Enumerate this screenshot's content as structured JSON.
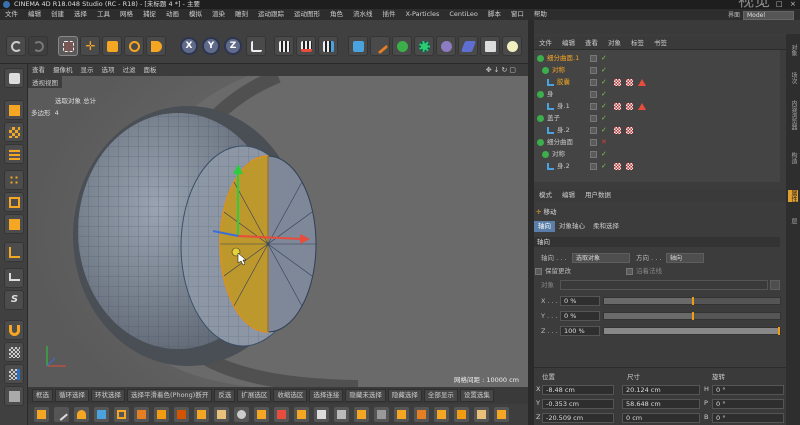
{
  "window": {
    "title": "CINEMA 4D R18.048 Studio (RC - R18) - [未标题 4 *] - 主要",
    "watermark": "视觉"
  },
  "menubar": {
    "items": [
      "文件",
      "编辑",
      "创建",
      "选择",
      "工具",
      "网格",
      "捕捉",
      "动画",
      "模拟",
      "渲染",
      "雕刻",
      "运动跟踪",
      "运动图形",
      "角色",
      "流水线",
      "插件",
      "X-Particles",
      "CentiLeo",
      "脚本",
      "窗口",
      "帮助"
    ],
    "layout_label": "界面",
    "layout_value": "Model"
  },
  "viewport": {
    "menu": [
      "查看",
      "摄像机",
      "显示",
      "选项",
      "过滤",
      "面板"
    ],
    "label": "透视视图",
    "hud_header": "选取对象 总计",
    "hud_row_label": "多边形",
    "hud_row_value": "4",
    "grid_spacing": "网格间距 : 10000 cm"
  },
  "cmdbar": {
    "items": [
      "框选",
      "循环选择",
      "环状选择",
      "选择平滑着色(Phong)断开",
      "反选",
      "扩展选区",
      "收缩选区",
      "选择连接",
      "隐藏未选择",
      "隐藏选择",
      "全部显示",
      "设置选集"
    ]
  },
  "objects": {
    "menu": [
      "文件",
      "编辑",
      "查看",
      "对象",
      "标签",
      "书签"
    ],
    "rows": [
      {
        "name": "细分曲面.1",
        "highlight": true
      },
      {
        "name": "对称",
        "highlight": true
      },
      {
        "name": "胶囊",
        "highlight": true
      },
      {
        "name": "身",
        "highlight": false
      },
      {
        "name": "身.1",
        "highlight": false
      },
      {
        "name": "盖子",
        "highlight": false
      },
      {
        "name": "身.2",
        "highlight": false
      },
      {
        "name": "细分曲面",
        "highlight": false
      },
      {
        "name": "对称",
        "highlight": false
      },
      {
        "name": "身.2",
        "highlight": false
      }
    ]
  },
  "attributes": {
    "menu": [
      "模式",
      "编辑",
      "用户数据"
    ],
    "title": "移动",
    "tabs": [
      "轴向",
      "对象轴心",
      "柔和选择"
    ],
    "section": "轴向",
    "axis_label": "轴向 . . .",
    "axis_value": "选取对象",
    "dir_label": "方向 . . .",
    "dir_value": "轴向",
    "keep_label": "保留更改",
    "snap_label": "沿着法线",
    "object_label": "对象",
    "x_label": "X . . .",
    "x_value": "0 %",
    "y_label": "Y . . .",
    "y_value": "0 %",
    "z_label": "Z . . .",
    "z_value": "100 %"
  },
  "coords": {
    "headers": [
      "位置",
      "尺寸",
      "旋转"
    ],
    "rows": [
      {
        "axis": "X",
        "pos": "-8.48 cm",
        "size": "20.124 cm",
        "rot_axis": "H",
        "rot": "0 °"
      },
      {
        "axis": "Y",
        "pos": "-0.353 cm",
        "size": "58.648 cm",
        "rot_axis": "P",
        "rot": "0 °"
      },
      {
        "axis": "Z",
        "pos": "-20.509 cm",
        "size": "0 cm",
        "rot_axis": "B",
        "rot": "0 °"
      }
    ]
  },
  "right_tabs": [
    "对象",
    "场次",
    "内容浏览器",
    "构造",
    "属性",
    "层"
  ],
  "colors": {
    "accent": "#f39c12",
    "tab_active": "#5a7ea8",
    "selection": "#c89b1a"
  }
}
